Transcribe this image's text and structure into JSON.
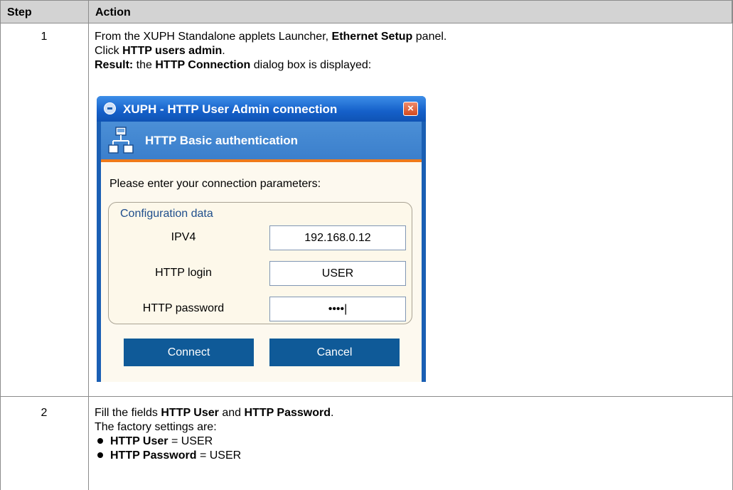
{
  "table": {
    "headers": {
      "step": "Step",
      "action": "Action"
    },
    "rows": [
      {
        "step": "1",
        "lines": [
          {
            "plain1": "From the XUPH Standalone applets Launcher, ",
            "bold1": "Ethernet Setup",
            "plain2": " panel."
          },
          {
            "plain1": "Click ",
            "bold1": "HTTP users admin",
            "plain2": "."
          },
          {
            "bold1": "Result:",
            "plain1": " the ",
            "bold2": "HTTP Connection",
            "plain2": " dialog box is displayed:"
          }
        ]
      },
      {
        "step": "2",
        "lines": [
          {
            "plain1": "Fill the fields ",
            "bold1": "HTTP User",
            "plain2": " and ",
            "bold2": "HTTP Password",
            "plain3": "."
          },
          {
            "plain1": "The factory settings are:"
          }
        ],
        "bullets": [
          {
            "bold": "HTTP User",
            "rest": " = USER"
          },
          {
            "bold": "HTTP Password",
            "rest": " = USER"
          }
        ]
      }
    ]
  },
  "dialog": {
    "title": "XUPH - HTTP User Admin connection",
    "close_label": "×",
    "banner": "HTTP Basic authentication",
    "prompt": "Please enter your connection parameters:",
    "group_title": "Configuration data",
    "fields": [
      {
        "label": "IPV4",
        "value": "192.168.0.12"
      },
      {
        "label": "HTTP login",
        "value": "USER"
      },
      {
        "label": "HTTP password",
        "value": "••••|"
      }
    ],
    "connect_label": "Connect",
    "cancel_label": "Cancel",
    "colors": {
      "titlebar": "#1560c9",
      "banner": "#3b7fcc",
      "accent": "#ef7a1a",
      "button": "#0f5a98",
      "body": "#fdf9ef"
    },
    "icons": {
      "title": "app-globe-icon",
      "banner": "network-icon",
      "close": "close-icon"
    }
  }
}
